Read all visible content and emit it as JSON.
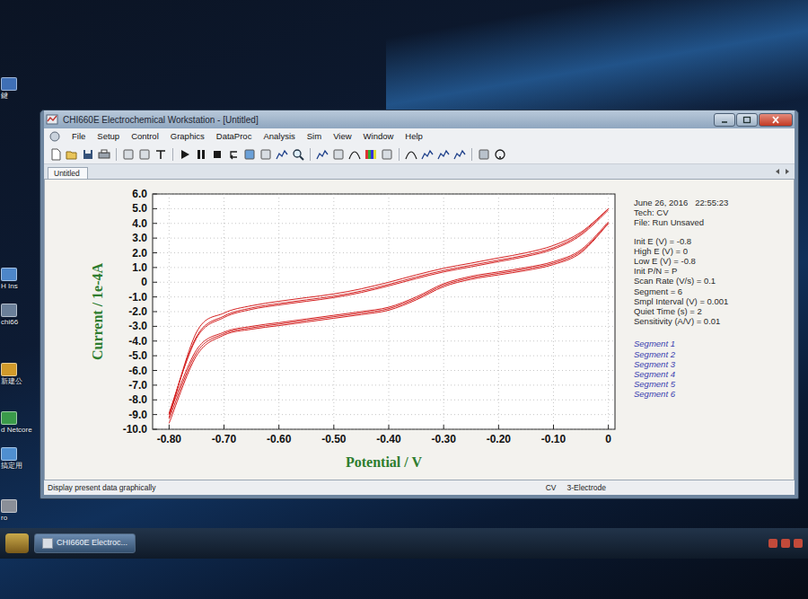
{
  "window": {
    "title": "CHI660E Electrochemical Workstation - [Untitled]"
  },
  "menu": [
    "File",
    "Setup",
    "Control",
    "Graphics",
    "DataProc",
    "Analysis",
    "Sim",
    "View",
    "Window",
    "Help"
  ],
  "tabs": [
    {
      "label": "Untitled",
      "selected": true
    }
  ],
  "chart": {
    "y_axis_label": "Current / 1e-4A",
    "x_axis_label": "Potential / V",
    "y_ticks": [
      {
        "label": "6.0",
        "value": 6
      },
      {
        "label": "5.0",
        "value": 5
      },
      {
        "label": "4.0",
        "value": 4
      },
      {
        "label": "3.0",
        "value": 3
      },
      {
        "label": "2.0",
        "value": 2
      },
      {
        "label": "1.0",
        "value": 1
      },
      {
        "label": "0",
        "value": 0
      },
      {
        "label": "-1.0",
        "value": -1
      },
      {
        "label": "-2.0",
        "value": -2
      },
      {
        "label": "-3.0",
        "value": -3
      },
      {
        "label": "-4.0",
        "value": -4
      },
      {
        "label": "-5.0",
        "value": -5
      },
      {
        "label": "-6.0",
        "value": -6
      },
      {
        "label": "-7.0",
        "value": -7
      },
      {
        "label": "-8.0",
        "value": -8
      },
      {
        "label": "-9.0",
        "value": -9
      },
      {
        "label": "-10.0",
        "value": -10
      }
    ],
    "x_ticks": [
      {
        "label": "-0.80",
        "value": -0.8
      },
      {
        "label": "-0.70",
        "value": -0.7
      },
      {
        "label": "-0.60",
        "value": -0.6
      },
      {
        "label": "-0.50",
        "value": -0.5
      },
      {
        "label": "-0.40",
        "value": -0.4
      },
      {
        "label": "-0.30",
        "value": -0.3
      },
      {
        "label": "-0.20",
        "value": -0.2
      },
      {
        "label": "-0.10",
        "value": -0.1
      },
      {
        "label": "0",
        "value": 0
      }
    ],
    "series": [
      {
        "name": "Segment 1",
        "potential": [
          -0.8,
          -0.75,
          -0.7,
          -0.65,
          -0.6,
          -0.55,
          -0.5,
          -0.45,
          -0.4,
          -0.35,
          -0.3,
          -0.25,
          -0.2,
          -0.15,
          -0.1,
          -0.05,
          0
        ],
        "current": [
          -9.2,
          -3.4,
          -2.1,
          -1.6,
          -1.3,
          -1.05,
          -0.8,
          -0.45,
          0.0,
          0.5,
          0.95,
          1.3,
          1.65,
          2.0,
          2.5,
          3.4,
          5.0
        ]
      },
      {
        "name": "Segment 2",
        "potential": [
          0,
          -0.05,
          -0.1,
          -0.15,
          -0.2,
          -0.25,
          -0.3,
          -0.35,
          -0.4,
          -0.45,
          -0.5,
          -0.55,
          -0.6,
          -0.65,
          -0.7,
          -0.75,
          -0.8
        ],
        "current": [
          4.0,
          2.0,
          1.2,
          0.8,
          0.5,
          0.2,
          -0.3,
          -1.2,
          -1.9,
          -2.2,
          -2.45,
          -2.7,
          -2.95,
          -3.2,
          -3.6,
          -5.0,
          -9.6
        ]
      },
      {
        "name": "Segment 3",
        "potential": [
          -0.8,
          -0.75,
          -0.7,
          -0.65,
          -0.6,
          -0.55,
          -0.5,
          -0.45,
          -0.4,
          -0.35,
          -0.3,
          -0.25,
          -0.2,
          -0.15,
          -0.1,
          -0.05,
          0
        ],
        "current": [
          -9.0,
          -3.7,
          -2.3,
          -1.75,
          -1.45,
          -1.2,
          -0.95,
          -0.6,
          -0.15,
          0.35,
          0.8,
          1.15,
          1.5,
          1.85,
          2.35,
          3.3,
          5.0
        ]
      },
      {
        "name": "Segment 4",
        "potential": [
          0,
          -0.05,
          -0.1,
          -0.15,
          -0.2,
          -0.25,
          -0.3,
          -0.35,
          -0.4,
          -0.45,
          -0.5,
          -0.55,
          -0.6,
          -0.65,
          -0.7,
          -0.75,
          -0.8
        ],
        "current": [
          4.0,
          2.1,
          1.3,
          0.9,
          0.6,
          0.3,
          -0.2,
          -1.1,
          -1.8,
          -2.1,
          -2.35,
          -2.6,
          -2.85,
          -3.1,
          -3.5,
          -4.8,
          -9.3
        ]
      },
      {
        "name": "Segment 5",
        "potential": [
          -0.8,
          -0.75,
          -0.7,
          -0.65,
          -0.6,
          -0.55,
          -0.5,
          -0.45,
          -0.4,
          -0.35,
          -0.3,
          -0.25,
          -0.2,
          -0.15,
          -0.1,
          -0.05,
          0
        ],
        "current": [
          -8.9,
          -3.8,
          -2.4,
          -1.85,
          -1.55,
          -1.3,
          -1.05,
          -0.7,
          -0.25,
          0.25,
          0.7,
          1.05,
          1.4,
          1.75,
          2.25,
          3.2,
          4.9
        ]
      },
      {
        "name": "Segment 6",
        "potential": [
          0,
          -0.05,
          -0.1,
          -0.15,
          -0.2,
          -0.25,
          -0.3,
          -0.35,
          -0.4,
          -0.45,
          -0.5,
          -0.55,
          -0.6,
          -0.65,
          -0.7,
          -0.75,
          -0.8
        ],
        "current": [
          4.1,
          2.2,
          1.4,
          1.0,
          0.7,
          0.4,
          -0.1,
          -1.0,
          -1.7,
          -2.0,
          -2.25,
          -2.5,
          -2.75,
          -3.0,
          -3.4,
          -4.6,
          -9.0
        ]
      }
    ]
  },
  "info": {
    "date": "June 26, 2016",
    "time": "22:55:23",
    "tech": "Tech: CV",
    "file": "File: Run Unsaved",
    "params": [
      "Init E (V) = -0.8",
      "High E (V) = 0",
      "Low E (V) = -0.8",
      "Init P/N = P",
      "Scan Rate (V/s) = 0.1",
      "Segment = 6",
      "Smpl Interval (V) = 0.001",
      "Quiet Time (s) = 2",
      "Sensitivity (A/V) = 0.01"
    ]
  },
  "status_bar": {
    "message": "Display present data graphically",
    "technique": "CV",
    "electrode": "3-Electrode"
  },
  "taskbar": {
    "items": [
      {
        "label": "CHI660E Electroc...",
        "selected": true
      }
    ]
  },
  "desktop_icons": [
    {
      "label": "鍵"
    },
    {
      "label": "H Ins"
    },
    {
      "label": "chi66"
    },
    {
      "label": "新建公"
    },
    {
      "label": "d Netcore"
    },
    {
      "label": "搞定用"
    },
    {
      "label": "ro"
    }
  ]
}
